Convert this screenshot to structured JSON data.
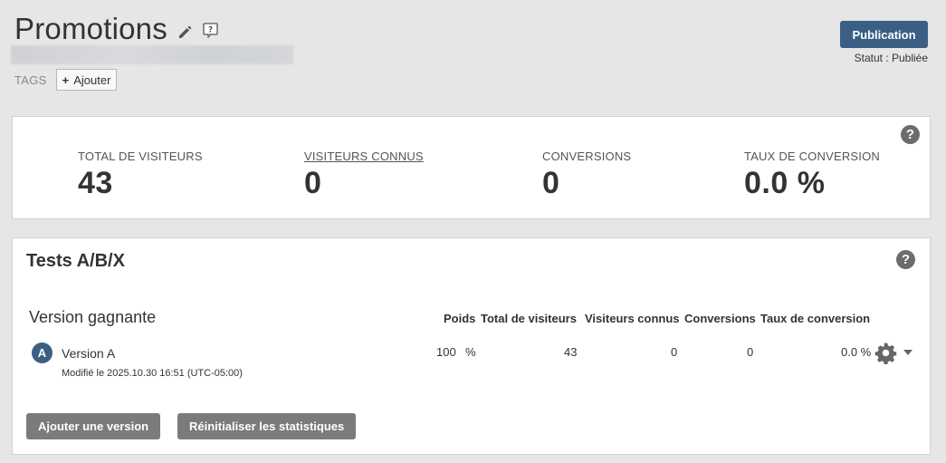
{
  "header": {
    "title": "Promotions",
    "tags_label": "TAGS",
    "add_tag_label": "Ajouter"
  },
  "publish": {
    "button_label": "Publication",
    "status": "Statut : Publiée"
  },
  "stats": {
    "items": [
      {
        "label": "TOTAL DE VISITEURS",
        "value": "43"
      },
      {
        "label": "VISITEURS CONNUS",
        "value": "0"
      },
      {
        "label": "CONVERSIONS",
        "value": "0"
      },
      {
        "label": "TAUX DE CONVERSION",
        "value": "0.0 %"
      }
    ]
  },
  "ab": {
    "title": "Tests A/B/X",
    "winner_label": "Version gagnante",
    "columns": [
      "Poids",
      "Total de visiteurs",
      "Visiteurs connus",
      "Conversions",
      "Taux de conversion"
    ],
    "versions": [
      {
        "badge": "A",
        "name": "Version A",
        "modified": "Modifié le 2025.10.30 16:51 (UTC-05:00)",
        "weight": "100",
        "weight_unit": "%",
        "total_visitors": "43",
        "known_visitors": "0",
        "conversions": "0",
        "conversion_rate": "0.0 %"
      }
    ],
    "add_version_label": "Ajouter une version",
    "reset_stats_label": "Réinitialiser les statistiques"
  },
  "colors": {
    "primary": "#3b5f82",
    "grey_button": "#7b7b7b",
    "background": "#e6e6e6"
  }
}
